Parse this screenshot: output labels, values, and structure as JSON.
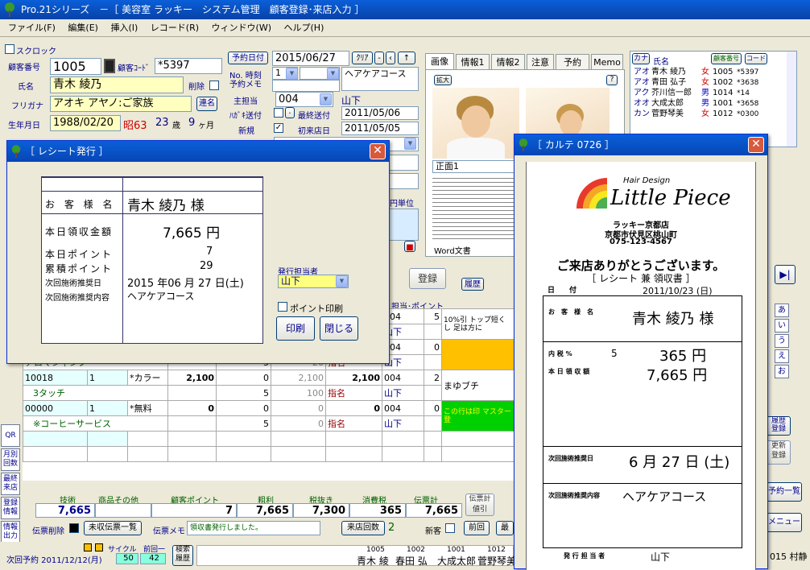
{
  "app": {
    "title": "Pro.21シリーズ　－［ 美容室 ラッキー　システム管理　顧客登録･来店入力 ］"
  },
  "menu": [
    "ファイル(F)",
    "編集(E)",
    "挿入(I)",
    "レコード(R)",
    "ウィンドウ(W)",
    "ヘルプ(H)"
  ],
  "form": {
    "sukuroku": "スクロック",
    "kokyaku_no_label": "顧客番号",
    "kokyaku_no": "1005",
    "kokyaku_code_label": "顧客ｺｰﾄﾞ",
    "kokyaku_code": "*5397",
    "name_label": "氏名",
    "name": "青木 綾乃",
    "delete_label": "削除",
    "furigana_label": "フリガナ",
    "furigana": "アオキ アヤノ:ご家族",
    "rensou_btn": "連名",
    "birth_label": "生年月日",
    "birth": "1988/02/20",
    "era": "昭63",
    "age_num": "23",
    "age_unit": "歳",
    "month_num": "9",
    "month_unit": "ヶ月",
    "yoyaku_date_btn": "予約日付",
    "yoyaku_date": "2015/06/27",
    "clear_btn": "ｸﾘｱ",
    "no_time_label": "No. 時刻",
    "no_value": "1",
    "yoyaku_memo_label": "予約メモ",
    "yoyaku_course": "ヘアケアコース",
    "shutanto_label": "主担当",
    "shutanto_code": "004",
    "shutanto_name": "山下",
    "hagaki_label": "ﾊｶﾞｷ送付",
    "saishu_label": "最終送付",
    "saishu_date": "2011/05/06",
    "shinki_label": "新規",
    "shoten_label": "初来店日",
    "shoten_date": "2011/05/05",
    "tanni_label": "円単位"
  },
  "tabs": [
    "画像",
    "情報1",
    "情報2",
    "注意",
    "予約",
    "Memo"
  ],
  "photo": {
    "kakudai": "拡大",
    "help": "?",
    "caption": "正面1",
    "doc": "Word文書"
  },
  "custlist": {
    "h_kana": "カナ",
    "h_name": "氏名",
    "h_no": "顧客番号",
    "h_code": "コード",
    "rows": [
      {
        "kana": "アオ",
        "name": "青木 綾乃",
        "sex": "女",
        "no": "1005",
        "code": "*5397"
      },
      {
        "kana": "アオ",
        "name": "青田 弘子",
        "sex": "女",
        "no": "1002",
        "code": "*3638"
      },
      {
        "kana": "アク",
        "name": "芥川信一郎",
        "sex": "男",
        "no": "1014",
        "code": "*14"
      },
      {
        "kana": "オオ",
        "name": "大成太郎",
        "sex": "男",
        "no": "1001",
        "code": "*3658"
      },
      {
        "kana": "カン",
        "name": "菅野琴美",
        "sex": "女",
        "no": "1012",
        "code": "*0300"
      }
    ]
  },
  "rowbtns": {
    "toroku": "登録",
    "rireki": "履歴"
  },
  "grid": {
    "tanto_label": "担当･ポイント",
    "rows": [
      {
        "code": "",
        "qty": "",
        "name": "",
        "price": "",
        "disc": "",
        "base": "",
        "amt": "",
        "tanto": "004",
        "pt": "5",
        "note": "10%引 トップ短くし 足は方に"
      },
      {
        "code": "",
        "qty": "",
        "name": "",
        "price": "",
        "disc": "",
        "base": "",
        "amt": "",
        "tanto": "山下",
        "pt": "",
        "note": ""
      },
      {
        "code": "",
        "qty": "",
        "name": "",
        "price": "",
        "disc": "",
        "base": "",
        "amt": "",
        "tanto": "004",
        "pt": "0",
        "note": ""
      },
      {
        "code": "",
        "qty": "",
        "name": "アロマシャンプ",
        "price": "",
        "disc": "5",
        "base": "20",
        "amt": "指名",
        "tanto": "山下",
        "pt": "",
        "note": ""
      },
      {
        "code": "10018",
        "qty": "1",
        "name": "*カラー",
        "price": "2,100",
        "disc": "0",
        "base": "2,100",
        "amt": "2,100",
        "tanto": "004",
        "pt": "2",
        "note": "まゆブチ"
      },
      {
        "code": "",
        "qty": "",
        "name": "3タッチ",
        "price": "",
        "disc": "5",
        "base": "100",
        "amt": "指名",
        "tanto": "山下",
        "pt": "",
        "note": ""
      },
      {
        "code": "00000",
        "qty": "1",
        "name": "*無料",
        "price": "0",
        "disc": "0",
        "base": "0",
        "amt": "0",
        "tanto": "004",
        "pt": "0",
        "note": "この行は印 マスター登"
      },
      {
        "code": "",
        "qty": "",
        "name": "※コーヒーサービス",
        "price": "",
        "disc": "5",
        "base": "0",
        "amt": "指名",
        "tanto": "山下",
        "pt": "",
        "note": ""
      }
    ]
  },
  "totals": {
    "h": [
      "技術",
      "商品その他",
      "顧客ポイント",
      "粗利",
      "税抜き",
      "消費税",
      "伝票計"
    ],
    "v": [
      "7,665",
      "",
      "7",
      "7,665",
      "7,300",
      "365",
      "7,665"
    ],
    "denpyo_kei": "伝票計 値引"
  },
  "bottom": {
    "denpyo_sakujo": "伝票削除",
    "misyu": "未収伝票一覧",
    "memo_label": "伝票メモ",
    "memo": "領収書発行しました。",
    "raiten_btn": "来店回数",
    "raiten": "2",
    "shinkyaku": "新客",
    "prev": "前回",
    "last": "最"
  },
  "status": {
    "jikai": "次回予約 2011/12/12(月)",
    "cycle": "サイクル",
    "zenkai": "前回一",
    "v1": "50",
    "v2": "42",
    "kensaku": "検索 履歴",
    "cust": [
      {
        "no": "1005",
        "name": "青木 綾"
      },
      {
        "no": "1002",
        "name": "春田 弘"
      },
      {
        "no": "1001",
        "name": "大成太郎"
      },
      {
        "no": "1012",
        "name": "菅野琴美"
      }
    ],
    "last": "015 村静"
  },
  "sidebtns": [
    "QR",
    "月別 回数",
    "最終 来店",
    "登録 情報",
    "情報 出力"
  ],
  "kana_btns": [
    "あ",
    "い",
    "う",
    "え",
    "お"
  ],
  "right_btns": {
    "yoyaku": "予約一覧",
    "menu": "メニュー",
    "rireki": "履歴 登録",
    "kaiin": "更新 登録"
  },
  "receipt": {
    "title": "［ レシート発行 ］",
    "okyakusama_label": "お 客 様 名",
    "okyakusama": "青木 綾乃 様",
    "ryoshu_label": "本日領収金額",
    "ryoshu": "7,665 円",
    "point_label": "本日ポイント",
    "point": "7",
    "ruikei_label": "累積ポイント",
    "ruikei": "29",
    "jikai_label": "次回施術推奨日",
    "jikai": "2015 年06 月 27 日(土)",
    "naiyo_label": "次回施術推奨内容",
    "naiyo": "ヘアケアコース",
    "tanto_label": "発行担当者",
    "tanto": "山下",
    "point_print": "ポイント印刷",
    "print_btn": "印刷",
    "close_btn": "閉じる"
  },
  "karte": {
    "title": "［ カルテ 0726 ］",
    "logo_small": "Hair Design",
    "logo_big": "Little Piece",
    "shop": "ラッキー京都店",
    "addr": "京都市伏見区桃山町",
    "tel": "075-123-4567",
    "thanks": "ご来店ありがとうございます。",
    "receipt_sub": "［ レシート 兼 領収書 ］",
    "date_label": "日　　付",
    "date": "2011/10/23 (日)",
    "okyaku_label": "お　客　様　名",
    "okyaku": "青木 綾乃 様",
    "zei_label": "内 税 %",
    "zei_rate": "5",
    "zei_amt": "365 円",
    "honjitsu_label": "本 日 領 収 額",
    "honjitsu": "7,665 円",
    "jikai_label": "次回施術推奨日",
    "jikai": "6 月 27 日 (土)",
    "naiyo_label": "次回施術推奨内容",
    "naiyo": "ヘアケアコース",
    "tanto_label": "発 行 担 当 者",
    "tanto": "山下"
  }
}
